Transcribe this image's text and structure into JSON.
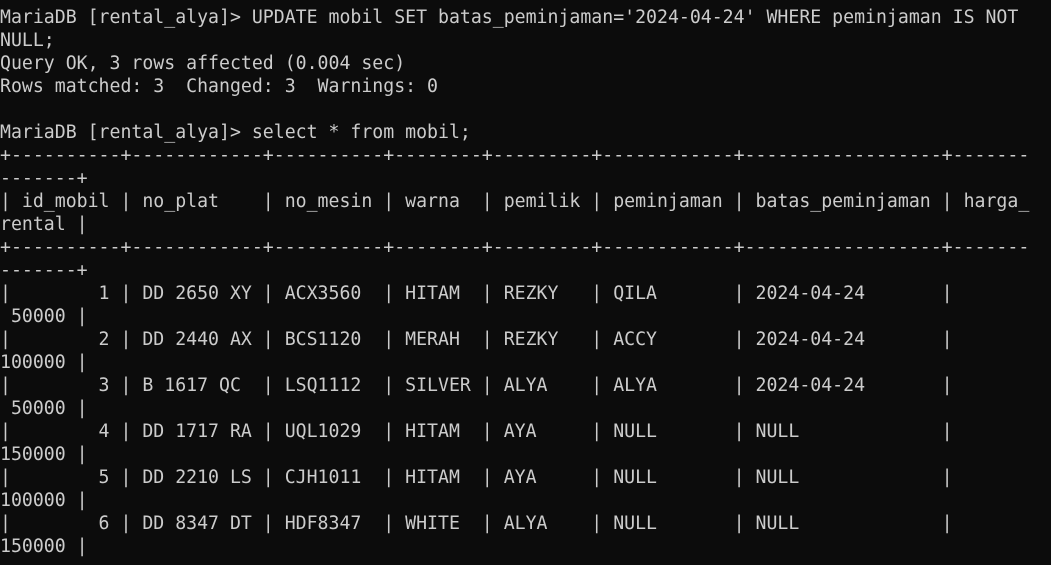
{
  "terminal": {
    "foreground": "#cccccc",
    "background": "#0c0c0c",
    "lines": [
      "MariaDB [rental_alya]> UPDATE mobil SET batas_peminjaman='2024-04-24' WHERE peminjaman IS NOT",
      "NULL;",
      "Query OK, 3 rows affected (0.004 sec)",
      "Rows matched: 3  Changed: 3  Warnings: 0",
      "",
      "MariaDB [rental_alya]> select * from mobil;",
      "+----------+------------+----------+--------+---------+------------+------------------+-------",
      "-------+",
      "| id_mobil | no_plat    | no_mesin | warna  | pemilik | peminjaman | batas_peminjaman | harga_",
      "rental |",
      "+----------+------------+----------+--------+---------+------------+------------------+-------",
      "-------+",
      "|        1 | DD 2650 XY | ACX3560  | HITAM  | REZKY   | QILA       | 2024-04-24       |",
      " 50000 |",
      "|        2 | DD 2440 AX | BCS1120  | MERAH  | REZKY   | ACCY       | 2024-04-24       |",
      "100000 |",
      "|        3 | B 1617 QC  | LSQ1112  | SILVER | ALYA    | ALYA       | 2024-04-24       |",
      " 50000 |",
      "|        4 | DD 1717 RA | UQL1029  | HITAM  | AYA     | NULL       | NULL             |",
      "150000 |",
      "|        5 | DD 2210 LS | CJH1011  | HITAM  | AYA     | NULL       | NULL             |",
      "100000 |",
      "|        6 | DD 8347 DT | HDF8347  | WHITE  | ALYA    | NULL       | NULL             |",
      "150000 |"
    ]
  }
}
